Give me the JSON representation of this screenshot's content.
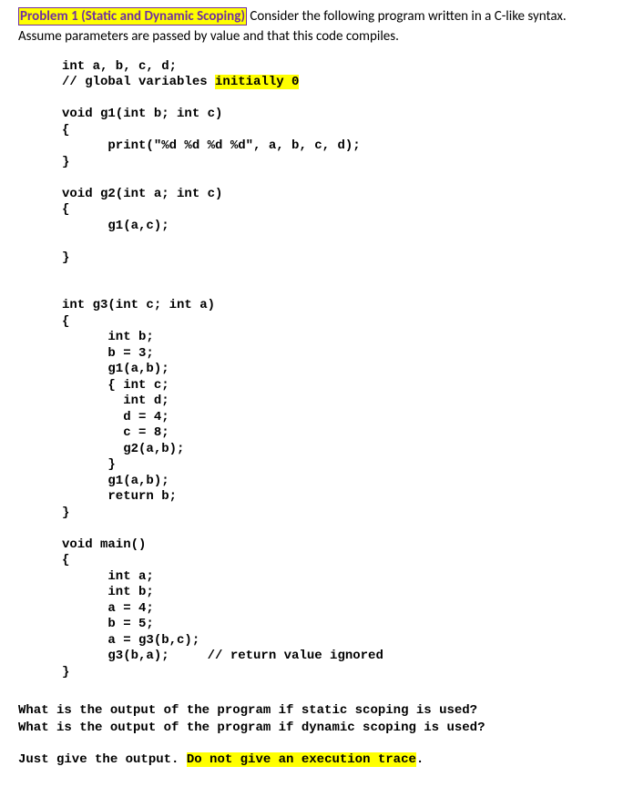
{
  "header": {
    "title": "Problem 1 (Static and Dynamic Scoping)",
    "intro1": " Consider the following program written in a C-like syntax.",
    "intro2": "Assume parameters are passed by value and that this code compiles."
  },
  "code": {
    "line1": "int a, b, c, d;",
    "line2a": "// global variables ",
    "line2b": "initially 0",
    "blank1": "",
    "g1_sig": "void g1(int b; int c)",
    "g1_open": "{",
    "g1_body": "      print(\"%d %d %d %d\", a, b, c, d);",
    "g1_close": "}",
    "blank2": "",
    "g2_sig": "void g2(int a; int c)",
    "g2_open": "{",
    "g2_body": "      g1(a,c);",
    "blank3": "",
    "g2_close": "}",
    "blank4": "",
    "blank5": "",
    "g3_sig": "int g3(int c; int a)",
    "g3_open": "{",
    "g3_l1": "      int b;",
    "g3_l2": "      b = 3;",
    "g3_l3": "      g1(a,b);",
    "g3_l4": "      { int c;",
    "g3_l5": "        int d;",
    "g3_l6": "        d = 4;",
    "g3_l7": "        c = 8;",
    "g3_l8": "        g2(a,b);",
    "g3_l9": "      }",
    "g3_l10": "      g1(a,b);",
    "g3_l11": "      return b;",
    "g3_close": "}",
    "blank6": "",
    "main_sig": "void main()",
    "main_open": "{",
    "main_l1": "      int a;",
    "main_l2": "      int b;",
    "main_l3": "      a = 4;",
    "main_l4": "      b = 5;",
    "main_l5": "      a = g3(b,c);",
    "main_l6": "      g3(b,a);     // return value ignored",
    "main_close": "}"
  },
  "questions": {
    "q1": "What is the output of the program if static scoping is used?",
    "q2": "What is the output of the program if dynamic scoping is used?"
  },
  "instruction": {
    "prefix": "Just give the output. ",
    "highlighted": "Do not give an execution trace",
    "suffix": "."
  }
}
